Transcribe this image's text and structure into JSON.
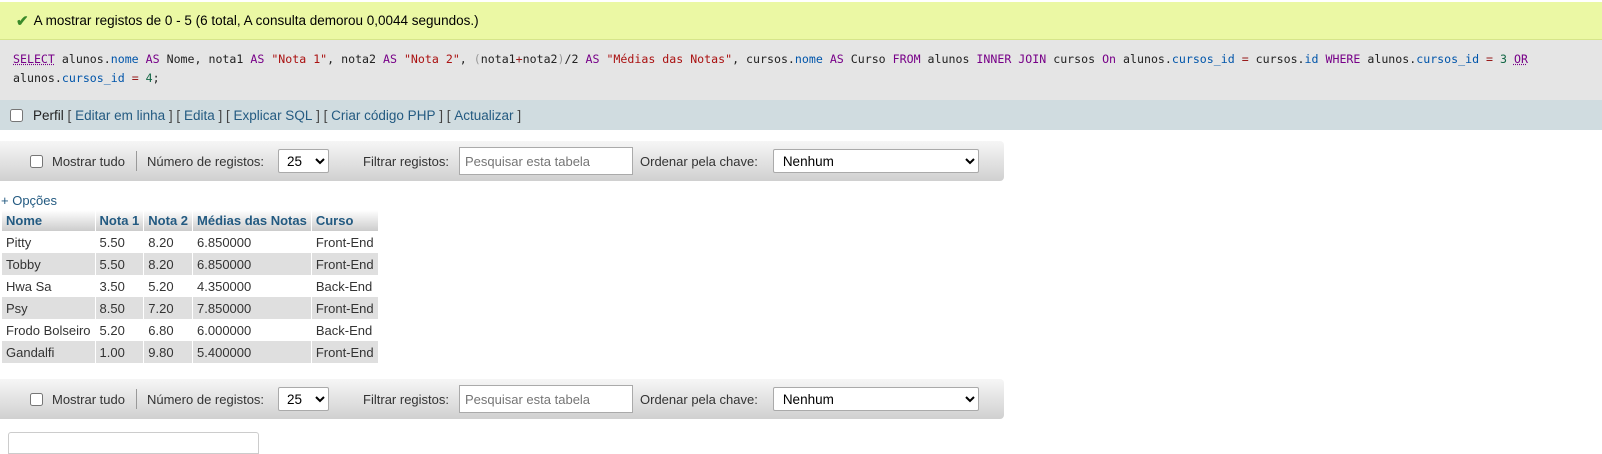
{
  "message": "A mostrar registos de 0 - 5 (6 total, A consulta demorou 0,0044 segundos.)",
  "sql_tokens": [
    {
      "t": "SELECT",
      "c": "kwu"
    },
    {
      "t": " alunos.",
      "c": ""
    },
    {
      "t": "nome",
      "c": "fld"
    },
    {
      "t": " ",
      "c": ""
    },
    {
      "t": "AS",
      "c": "kw"
    },
    {
      "t": " Nome, nota1 ",
      "c": ""
    },
    {
      "t": "AS",
      "c": "kw"
    },
    {
      "t": " ",
      "c": ""
    },
    {
      "t": "\"Nota 1\"",
      "c": "str"
    },
    {
      "t": ", nota2 ",
      "c": ""
    },
    {
      "t": "AS",
      "c": "kw"
    },
    {
      "t": " ",
      "c": ""
    },
    {
      "t": "\"Nota 2\"",
      "c": "str"
    },
    {
      "t": ", ",
      "c": ""
    },
    {
      "t": "(",
      "c": "bkt"
    },
    {
      "t": "nota1",
      "c": ""
    },
    {
      "t": "+",
      "c": "op"
    },
    {
      "t": "nota2",
      "c": ""
    },
    {
      "t": ")",
      "c": "bkt"
    },
    {
      "t": "/2 ",
      "c": ""
    },
    {
      "t": "AS",
      "c": "kw"
    },
    {
      "t": " ",
      "c": ""
    },
    {
      "t": "\"Médias das Notas\"",
      "c": "str"
    },
    {
      "t": ", cursos.",
      "c": ""
    },
    {
      "t": "nome",
      "c": "fld"
    },
    {
      "t": " ",
      "c": ""
    },
    {
      "t": "AS",
      "c": "kw"
    },
    {
      "t": " Curso ",
      "c": ""
    },
    {
      "t": "FROM",
      "c": "kw"
    },
    {
      "t": " alunos ",
      "c": ""
    },
    {
      "t": "INNER JOIN",
      "c": "kw"
    },
    {
      "t": " cursos ",
      "c": ""
    },
    {
      "t": "On",
      "c": "kw"
    },
    {
      "t": " alunos.",
      "c": ""
    },
    {
      "t": "cursos_id",
      "c": "fld"
    },
    {
      "t": " ",
      "c": ""
    },
    {
      "t": "=",
      "c": "op"
    },
    {
      "t": " cursos.",
      "c": ""
    },
    {
      "t": "id",
      "c": "fld"
    },
    {
      "t": " ",
      "c": ""
    },
    {
      "t": "WHERE",
      "c": "kw"
    },
    {
      "t": " alunos.",
      "c": ""
    },
    {
      "t": "cursos_id",
      "c": "fld"
    },
    {
      "t": " ",
      "c": ""
    },
    {
      "t": "=",
      "c": "op"
    },
    {
      "t": " ",
      "c": ""
    },
    {
      "t": "3",
      "c": "num"
    },
    {
      "t": " ",
      "c": ""
    },
    {
      "t": "OR",
      "c": "kwu"
    },
    {
      "t": "\nalunos.",
      "c": ""
    },
    {
      "t": "cursos_id",
      "c": "fld"
    },
    {
      "t": " ",
      "c": ""
    },
    {
      "t": "=",
      "c": "op"
    },
    {
      "t": " ",
      "c": ""
    },
    {
      "t": "4",
      "c": "num"
    },
    {
      "t": ";",
      "c": ""
    }
  ],
  "toolbar": {
    "perfil": "Perfil",
    "links": [
      "Editar em linha",
      "Edita",
      "Explicar SQL",
      "Criar código PHP",
      "Actualizar"
    ]
  },
  "navbar": {
    "show_all": "Mostrar tudo",
    "num_rows_label": "Número de registos:",
    "num_rows_value": "25",
    "filter_label": "Filtrar registos:",
    "filter_placeholder": "Pesquisar esta tabela",
    "sort_label": "Ordenar pela chave:",
    "sort_value": "Nenhum"
  },
  "options_link": "+ Opções",
  "table": {
    "columns": [
      "Nome",
      "Nota 1",
      "Nota 2",
      "Médias das Notas",
      "Curso"
    ],
    "rows": [
      [
        "Pitty",
        "5.50",
        "8.20",
        "6.850000",
        "Front-End"
      ],
      [
        "Tobby",
        "5.50",
        "8.20",
        "6.850000",
        "Front-End"
      ],
      [
        "Hwa Sa",
        "3.50",
        "5.20",
        "4.350000",
        "Back-End"
      ],
      [
        "Psy",
        "8.50",
        "7.20",
        "7.850000",
        "Front-End"
      ],
      [
        "Frodo Bolseiro",
        "5.20",
        "6.80",
        "6.000000",
        "Back-End"
      ],
      [
        "Gandalfi",
        "1.00",
        "9.80",
        "5.400000",
        "Front-End"
      ]
    ]
  },
  "colors": {
    "success_bg": "#ebf8a4",
    "link": "#235a81",
    "toolbar_bg": "#d0dce0"
  }
}
